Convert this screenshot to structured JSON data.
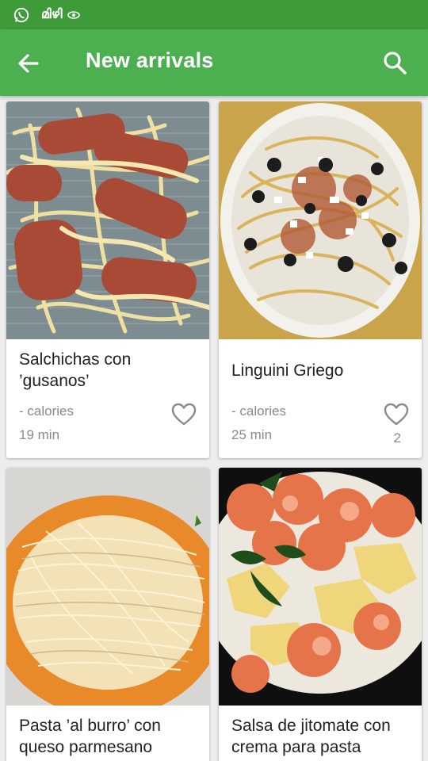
{
  "status_bar": {
    "notification_text": "മിഴി",
    "icons": [
      "whatsapp-icon",
      "eye-icon"
    ]
  },
  "app_bar": {
    "title": "New arrivals",
    "back_icon": "arrow-back-icon",
    "search_icon": "search-icon"
  },
  "colors": {
    "status_bar": "#3f9a3a",
    "app_bar": "#4caf50",
    "background": "#ededed",
    "secondary_text": "#8a8a8a"
  },
  "recipes": [
    {
      "name": "Salchichas con ’gusanos’",
      "calories": "- calories",
      "time": "19 min",
      "favorites": "",
      "icon": "heart-outline-icon"
    },
    {
      "name": "Linguini Griego",
      "calories": "- calories",
      "time": "25 min",
      "favorites": "2",
      "icon": "heart-outline-icon"
    },
    {
      "name": "Pasta ’al burro’ con queso parmesano",
      "calories": "",
      "time": "",
      "favorites": "",
      "icon": "heart-outline-icon"
    },
    {
      "name": "Salsa de jitomate con crema para pasta",
      "calories": "",
      "time": "",
      "favorites": "",
      "icon": "heart-outline-icon"
    }
  ]
}
